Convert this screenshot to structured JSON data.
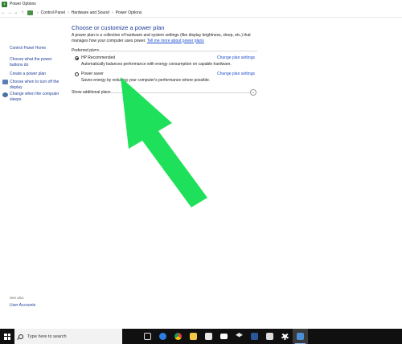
{
  "window": {
    "title": "Power Options"
  },
  "address": {
    "nav": {
      "back": "←",
      "forward": "→",
      "recent": "⌄",
      "up": "↑"
    },
    "breadcrumbs": [
      "Control Panel",
      "Hardware and Sound",
      "Power Options"
    ],
    "separator": "›"
  },
  "sidebar": {
    "home": "Control Panel Home",
    "items": [
      "Choose what the power buttons do",
      "Create a power plan",
      "Choose when to turn off the display",
      "Change when the computer sleeps"
    ],
    "see_also_label": "See also",
    "see_also_items": [
      "User Accounts"
    ]
  },
  "main": {
    "heading": "Choose or customize a power plan",
    "description": "A power plan is a collection of hardware and system settings (like display brightness, sleep, etc.) that manages how your computer uses power.",
    "description_link": "Tell me more about power plans",
    "group_label": "Preferred plans",
    "plans": [
      {
        "name": "HP Recommended",
        "description": "Automatically balances performance with energy consumption on capable hardware.",
        "change_label": "Change plan settings",
        "selected": true
      },
      {
        "name": "Power saver",
        "description": "Saves energy by reducing your computer's performance where possible.",
        "change_label": "Change plan settings",
        "selected": false
      }
    ],
    "show_more": "Show additional plans",
    "expand_glyph": "⌄"
  },
  "annotation": {
    "arrow_color": "#1ee05a"
  },
  "taskbar": {
    "search_placeholder": "Type here to search",
    "icons": [
      "task-view-icon",
      "edge-icon",
      "chrome-icon",
      "file-explorer-icon",
      "store-icon",
      "mail-icon",
      "dropbox-icon",
      "word-icon",
      "notepad-icon",
      "settings-icon",
      "power-options-icon"
    ]
  }
}
